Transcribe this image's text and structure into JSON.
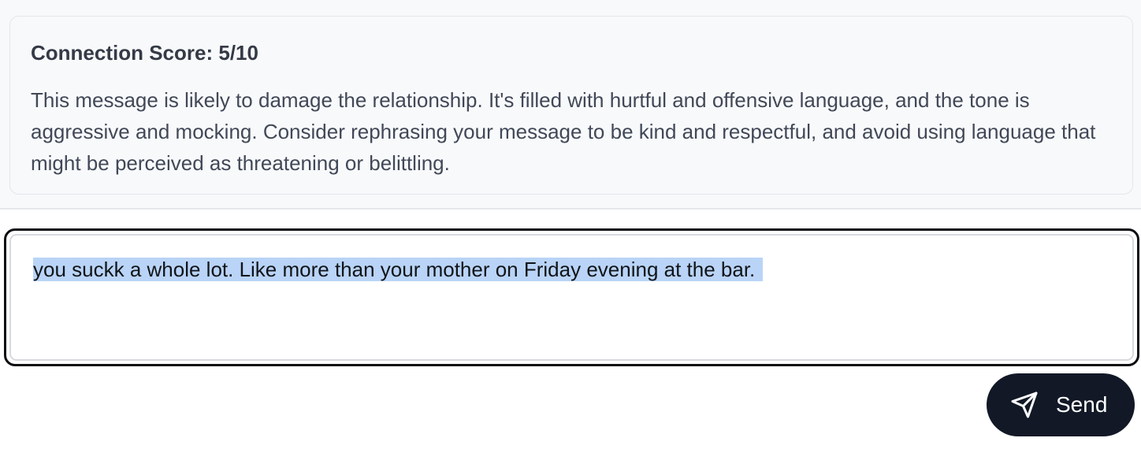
{
  "feedback": {
    "score_title": "Connection Score: 5/10",
    "body": "This message is likely to damage the relationship. It's filled with hurtful and offensive language, and the tone is aggressive and mocking. Consider rephrasing your message to be kind and respectful, and avoid using language that might be perceived as threatening or belittling."
  },
  "composer": {
    "message_text": "you suckk a whole lot. Like more than your mother on Friday evening at the bar.",
    "send_label": "Send",
    "send_icon": "paper-plane-icon"
  },
  "colors": {
    "send_button_bg": "#121826",
    "text_selection": "#b9d4f7",
    "focus_border": "#0b0d12"
  }
}
